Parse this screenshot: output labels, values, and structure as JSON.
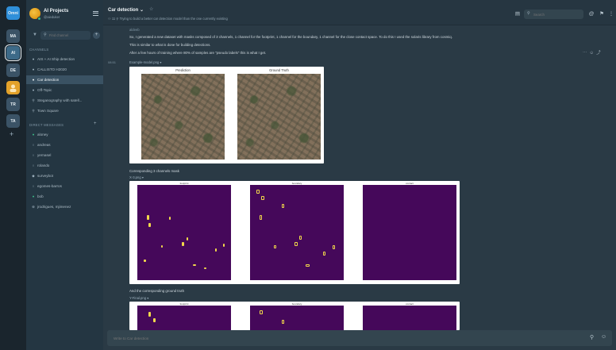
{
  "teams": [
    {
      "label": "Omni",
      "color": "#2f8fd9"
    },
    {
      "label": "MA",
      "color": "#3b5366"
    },
    {
      "label": "AI",
      "color": "#3d6a88"
    },
    {
      "label": "DE",
      "color": "#3b5366"
    },
    {
      "label": "",
      "color": "#e3a22a"
    },
    {
      "label": "TR",
      "color": "#3b5366"
    },
    {
      "label": "TA",
      "color": "#3b5366"
    }
  ],
  "sidebar": {
    "team_name": "AI Projects",
    "team_user": "@aieduker",
    "find_placeholder": "Find channel",
    "channels_label": "CHANNELS",
    "channels": [
      {
        "sym": "●",
        "label": "AIS + AI Ship detection"
      },
      {
        "sym": "●",
        "label": "CALLISTO H2020"
      },
      {
        "sym": "●",
        "label": "Car detection",
        "active": true
      },
      {
        "sym": "●",
        "label": "Off-Topic"
      },
      {
        "sym": "⚲",
        "label": "Steganography with satell..."
      },
      {
        "sym": "⚲",
        "label": "Town Square"
      }
    ],
    "dm_label": "DIRECT MESSAGES",
    "dms": [
      {
        "sym": "●",
        "label": "aloney",
        "color": "#3db887"
      },
      {
        "sym": "○",
        "label": "andreas",
        "color": "#9cb0bd"
      },
      {
        "sym": "○",
        "label": "yernasel",
        "color": "#9cb0bd"
      },
      {
        "sym": "○",
        "label": "rolando",
        "color": "#9cb0bd"
      },
      {
        "sym": "◆",
        "label": "surveybot",
        "color": "#9cb0bd"
      },
      {
        "sym": "○",
        "label": "egomes-barros",
        "color": "#9cb0bd"
      },
      {
        "sym": "●",
        "label": "bob",
        "color": "#3db887"
      },
      {
        "sym": "⊕",
        "label": "jrodrigues, mjimenez",
        "color": "#9cb0bd"
      }
    ]
  },
  "header": {
    "title": "Car detection ⌄",
    "meta": "⚇ 11  ⚲  Trying to build a better car detection model than the one currently existing",
    "search_placeholder": "Search"
  },
  "post": {
    "sender": "aldeeb",
    "time": "08:51",
    "lines": [
      "So, I generated a new dataset with masks composed of 3 channels, 1 channel for the footprint, 1 channel for the boundary, 1 channel for the close contact space. To do this I used the solaris library from cosmiq.",
      "This is similar to what is done for building detections.",
      "After a few hours of training where 80% of samples are \"pseudo labels\" this is what I get."
    ],
    "file1": "Example-model.png ▾",
    "panel_pred": "Prediction",
    "panel_gt": "Ground Truth",
    "caption2": "Corresponding 3 channels mask",
    "file2": "X-3.png ▾",
    "mask_titles": [
      "footprint",
      "boundary",
      "contact"
    ],
    "caption3": "And the corresponding ground truth",
    "file3": "Y-Final.png ▾"
  },
  "composer": {
    "placeholder": "Write to Car detection"
  }
}
